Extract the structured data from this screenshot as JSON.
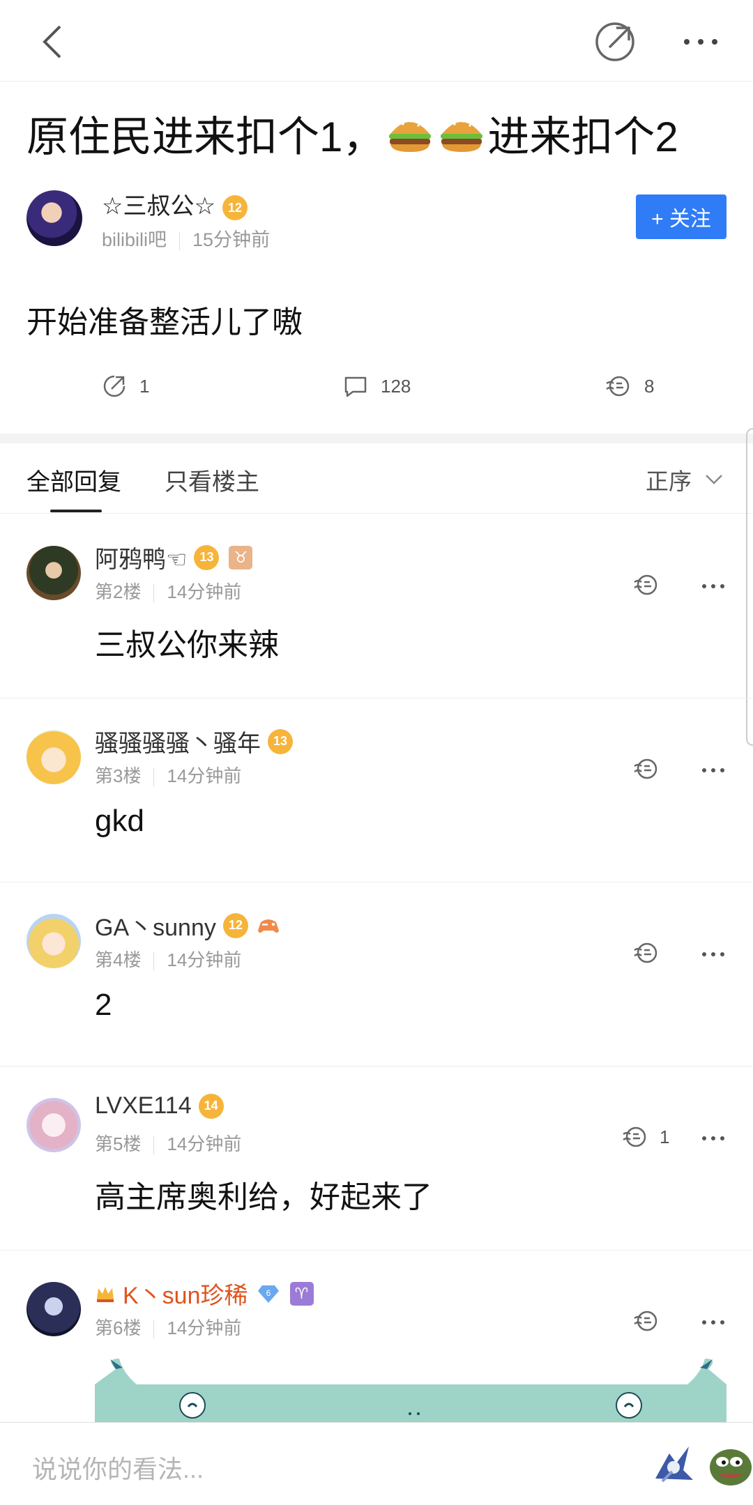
{
  "post": {
    "title_part1": "原住民进来扣个1，",
    "title_part2": "进来扣个2",
    "title_emoji": "hamburger-icon",
    "author": {
      "name": "☆三叔公☆",
      "level": "12",
      "forum": "bilibili吧",
      "time": "15分钟前"
    },
    "follow_label": "+ 关注",
    "body": "开始准备整活儿了嗷",
    "stats": {
      "shares": "1",
      "comments": "128",
      "likes": "8"
    }
  },
  "tabs": {
    "all": "全部回复",
    "op_only": "只看楼主",
    "sort": "正序"
  },
  "replies": [
    {
      "name": "阿鸦鸭☜",
      "level": "13",
      "badge": "♉",
      "floor": "第2楼",
      "time": "14分钟前",
      "content": "三叔公你来辣",
      "likes": ""
    },
    {
      "name": "骚骚骚骚丶骚年",
      "level": "13",
      "floor": "第3楼",
      "time": "14分钟前",
      "content": "gkd",
      "likes": ""
    },
    {
      "name": "GA丶sunny",
      "level": "12",
      "floor": "第4楼",
      "time": "14分钟前",
      "content": "2",
      "likes": ""
    },
    {
      "name": "LVXE114",
      "level": "14",
      "floor": "第5楼",
      "time": "14分钟前",
      "content": "高主席奥利给，好起来了",
      "likes": "1"
    },
    {
      "name": "K丶sun珍稀",
      "level": "6",
      "badge": "♈",
      "floor": "第6楼",
      "time": "14分钟前",
      "content": "",
      "likes": ""
    }
  ],
  "input_placeholder": "说说你的看法...",
  "colors": {
    "accent": "#2f7cf6",
    "vip_name": "#e0531d",
    "level_badge": "#f6b43a"
  }
}
